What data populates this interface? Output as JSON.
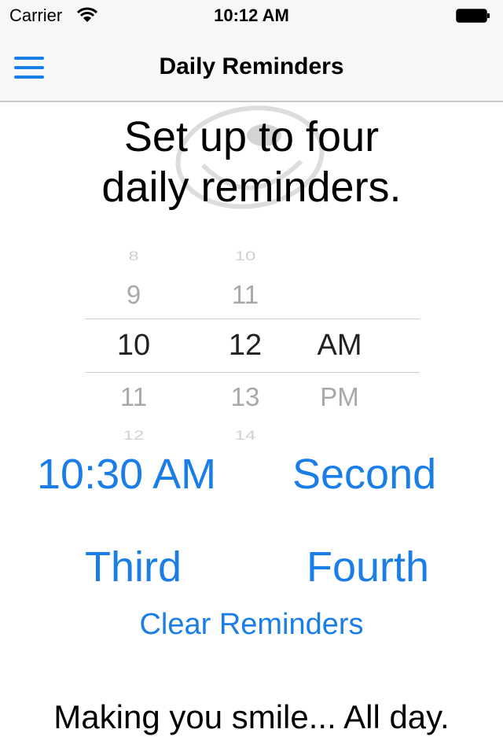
{
  "status_bar": {
    "carrier": "Carrier",
    "time": "10:12 AM"
  },
  "nav": {
    "title": "Daily Reminders",
    "menu_icon": "hamburger-menu-icon"
  },
  "headline": {
    "line1": "Set up to four",
    "line2": "daily reminders."
  },
  "picker": {
    "hours": [
      "8",
      "9",
      "10",
      "11",
      "12"
    ],
    "minutes": [
      "10",
      "11",
      "12",
      "13",
      "14"
    ],
    "period": [
      "AM",
      "PM"
    ],
    "selected": {
      "hour": "10",
      "minute": "12",
      "period": "AM"
    }
  },
  "reminders": {
    "first": "10:30 AM",
    "second": "Second",
    "third": "Third",
    "fourth": "Fourth",
    "clear": "Clear Reminders"
  },
  "footer": {
    "tagline": "Making you smile... All day."
  },
  "colors": {
    "accent": "#1a7ee6"
  }
}
